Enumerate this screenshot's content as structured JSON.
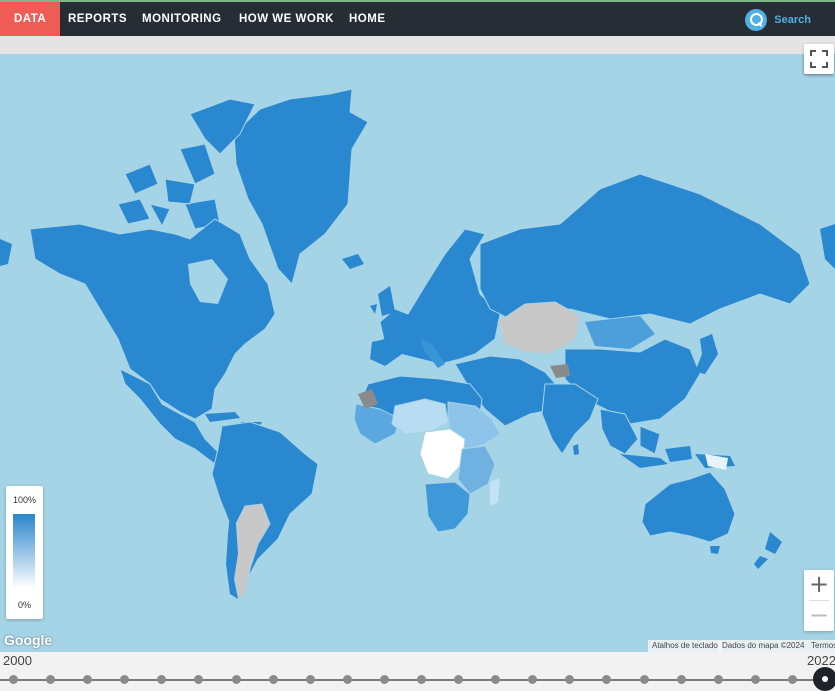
{
  "nav": {
    "items": [
      {
        "label": "DATA",
        "active": true
      },
      {
        "label": "REPORTS"
      },
      {
        "label": "MONITORING"
      },
      {
        "label": "HOW WE WORK"
      },
      {
        "label": "HOME"
      }
    ],
    "search_label": "Search"
  },
  "legend": {
    "max_label": "100%",
    "min_label": "0%",
    "colors": {
      "high": "#2a85cc",
      "low": "#ffffff",
      "no_data": "#c8c8c8",
      "ocean": "#a5d4e6"
    }
  },
  "map": {
    "provider": "Google",
    "attribution": {
      "shortcuts": "Atalhos de teclado",
      "data": "Dados do mapa ©2024",
      "terms": "Termos"
    },
    "zoom_in": "+",
    "zoom_out": "−"
  },
  "timeline": {
    "start_year": "2000",
    "end_year": "2022",
    "selected_year": "2022"
  }
}
